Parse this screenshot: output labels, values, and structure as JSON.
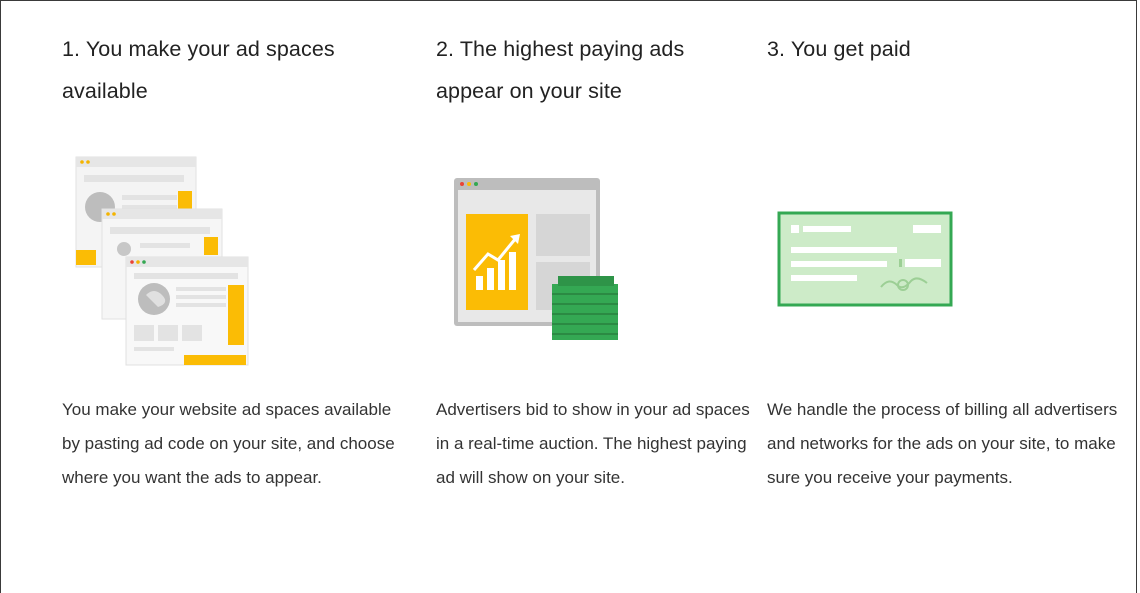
{
  "steps": [
    {
      "heading": "1. You make your ad spaces available",
      "illustration": "stacked-webpages-icon",
      "description": "You make your website ad spaces available by pasting ad code on your site, and choose where you want the ads to appear."
    },
    {
      "heading": "2. The highest paying ads appear on your site",
      "illustration": "browser-chart-money-icon",
      "description": "Advertisers bid to show in your ad spaces in a real-time auction. The highest paying ad will show on your site."
    },
    {
      "heading": "3. You get paid",
      "illustration": "check-payment-icon",
      "description": "We handle the process of billing all advertisers and networks for the ads on your site, to make sure you receive your payments."
    }
  ],
  "colors": {
    "accent_yellow": "#FBBC05",
    "accent_green": "#34A853",
    "check_fill": "#CDEBC8",
    "window_gray": "#E8E8E8"
  }
}
